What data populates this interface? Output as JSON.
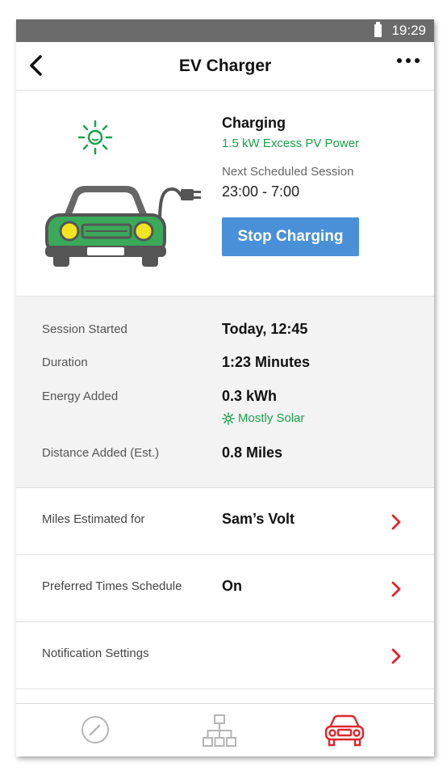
{
  "status": {
    "time": "19:29"
  },
  "header": {
    "title": "EV Charger"
  },
  "hero": {
    "status_label": "Charging",
    "power_label": "1.5 kW Excess PV Power",
    "next_session_label": "Next Scheduled Session",
    "next_session_time": "23:00 - 7:00",
    "stop_button": "Stop Charging"
  },
  "session": {
    "rows": [
      {
        "label": "Session Started",
        "value": "Today, 12:45"
      },
      {
        "label": "Duration",
        "value": "1:23 Minutes"
      },
      {
        "label": "Energy Added",
        "value": "0.3 kWh",
        "note": "Mostly Solar"
      },
      {
        "label": "Distance Added  (Est.)",
        "value": "0.8 Miles"
      }
    ]
  },
  "settings": [
    {
      "label": "Miles Estimated for",
      "value": "Sam’s Volt"
    },
    {
      "label": "Preferred Times Schedule",
      "value": "On"
    },
    {
      "label": "Notification Settings",
      "value": ""
    }
  ],
  "tabs": [
    {
      "name": "gauge-icon",
      "active": false
    },
    {
      "name": "network-icon",
      "active": false
    },
    {
      "name": "car-icon",
      "active": true
    }
  ],
  "colors": {
    "accent_green": "#19a24a",
    "button_blue": "#4a90d9",
    "active_red": "#e0252b",
    "car_green": "#3aaa5a"
  }
}
